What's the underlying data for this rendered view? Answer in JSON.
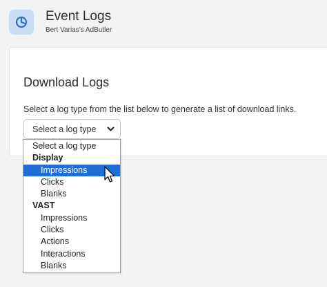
{
  "header": {
    "title": "Event Logs",
    "subtitle": "Bert Varias's AdButler",
    "icon": "pie-chart-icon"
  },
  "card": {
    "title": "Download Logs",
    "description": "Select a log type from the list below to generate a list of download links."
  },
  "log_type_select": {
    "value": "Select a log type",
    "icon": "chevron-down-icon"
  },
  "dropdown": {
    "placeholder_option": "Select a log type",
    "groups": [
      {
        "label": "Display",
        "options": [
          "Impressions",
          "Clicks",
          "Blanks"
        ]
      },
      {
        "label": "VAST",
        "options": [
          "Impressions",
          "Clicks",
          "Actions",
          "Interactions",
          "Blanks"
        ]
      }
    ],
    "highlighted": "Display / Impressions"
  },
  "colors": {
    "accent": "#1f6fd6",
    "icon_bg": "#c9ddf3",
    "icon_fg": "#2f6fd0"
  }
}
